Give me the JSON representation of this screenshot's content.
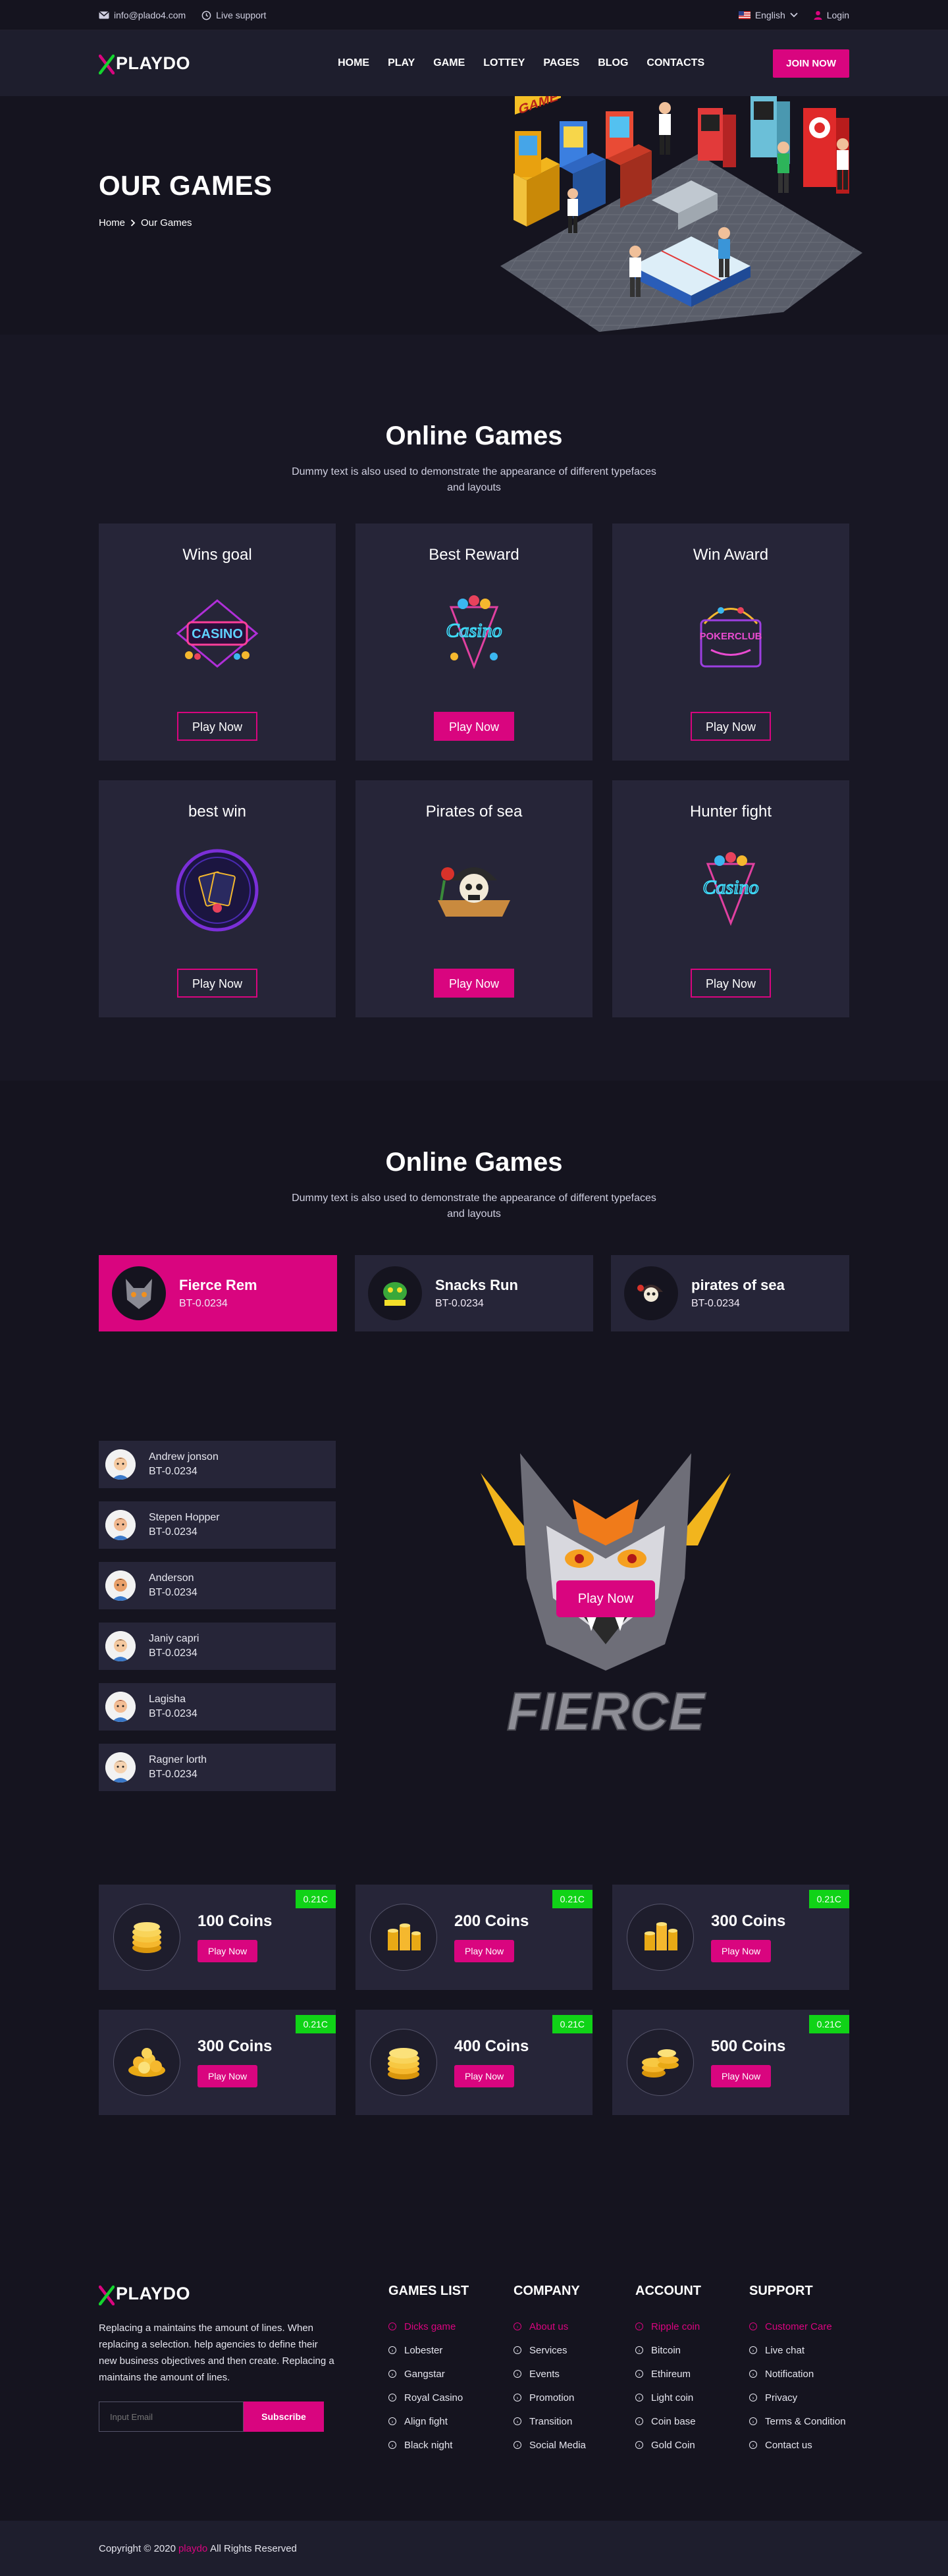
{
  "topbar": {
    "email": "info@plado4.com",
    "support": "Live support",
    "language": "English",
    "login": "Login"
  },
  "header": {
    "logo": "PLAYDO",
    "nav": [
      "HOME",
      "PLAY",
      "GAME",
      "LOTTEY",
      "PAGES",
      "BLOG",
      "CONTACTS"
    ],
    "join": "JOIN NOW"
  },
  "hero": {
    "title": "OUR GAMES",
    "crumb_home": "Home",
    "crumb_current": "Our Games",
    "sign_text": "GAME"
  },
  "games_section": {
    "title": "Online Games",
    "subtitle": "Dummy text is also used to demonstrate the appearance of different typefaces and layouts",
    "cards": [
      {
        "title": "Wins goal",
        "button": "Play Now",
        "filled": false,
        "logo": "CASINO"
      },
      {
        "title": "Best Reward",
        "button": "Play Now",
        "filled": true,
        "logo": "Casino"
      },
      {
        "title": "Win Award",
        "button": "Play Now",
        "filled": false,
        "logo": "POKERCLUB"
      },
      {
        "title": "best win",
        "button": "Play Now",
        "filled": false,
        "logo": ""
      },
      {
        "title": "Pirates of sea",
        "button": "Play Now",
        "filled": true,
        "logo": ""
      },
      {
        "title": "Hunter fight",
        "button": "Play Now",
        "filled": false,
        "logo": "Casino"
      }
    ]
  },
  "leaderboard": {
    "title": "Online Games",
    "subtitle": "Dummy text is also used to demonstrate the appearance of different typefaces and layouts",
    "tabs": [
      {
        "name": "Fierce Rem",
        "bt": "BT-0.0234",
        "active": true
      },
      {
        "name": "Snacks Run",
        "bt": "BT-0.0234",
        "active": false
      },
      {
        "name": "pirates of sea",
        "bt": "BT-0.0234",
        "active": false
      }
    ],
    "players": [
      {
        "name": "Andrew jonson",
        "bt": "BT-0.0234",
        "skin": "#f5c9a0",
        "hair": "#4a2e1b"
      },
      {
        "name": "Stepen Hopper",
        "bt": "BT-0.0234",
        "skin": "#f1b88f",
        "hair": "#3b2416"
      },
      {
        "name": "Anderson",
        "bt": "BT-0.0234",
        "skin": "#e9a06a",
        "hair": "#1f1410"
      },
      {
        "name": "Janiy capri",
        "bt": "BT-0.0234",
        "skin": "#f5c9a0",
        "hair": "#171212"
      },
      {
        "name": "Lagisha",
        "bt": "BT-0.0234",
        "skin": "#f3bd94",
        "hair": "#6b1a1a"
      },
      {
        "name": "Ragner lorth",
        "bt": "BT-0.0234",
        "skin": "#f5d2b0",
        "hair": "#2e2a2a"
      }
    ],
    "feature_button": "Play Now",
    "feature_text": "FIERCE"
  },
  "coins": [
    {
      "title": "100 Coins",
      "badge": "0.21C",
      "button": "Play Now"
    },
    {
      "title": "200 Coins",
      "badge": "0.21C",
      "button": "Play Now"
    },
    {
      "title": "300 Coins",
      "badge": "0.21C",
      "button": "Play Now"
    },
    {
      "title": "300 Coins",
      "badge": "0.21C",
      "button": "Play Now"
    },
    {
      "title": "400 Coins",
      "badge": "0.21C",
      "button": "Play Now"
    },
    {
      "title": "500 Coins",
      "badge": "0.21C",
      "button": "Play Now"
    }
  ],
  "footer": {
    "logo": "PLAYDO",
    "text": "Replacing a maintains the amount of lines. When replacing a selection. help agencies to define their new business objectives and then create. Replacing a maintains the amount of lines.",
    "email_placeholder": "Input Email",
    "subscribe": "Subscribe",
    "columns": [
      {
        "title": "GAMES LIST",
        "items": [
          "Dicks game",
          "Lobester",
          "Gangstar",
          "Royal Casino",
          "Align fight",
          "Black night"
        ]
      },
      {
        "title": "COMPANY",
        "items": [
          "About us",
          "Services",
          "Events",
          "Promotion",
          "Transition",
          "Social Media"
        ]
      },
      {
        "title": "ACCOUNT",
        "items": [
          "Ripple coin",
          "Bitcoin",
          "Ethireum",
          "Light coin",
          "Coin base",
          "Gold Coin"
        ]
      },
      {
        "title": "SUPPORT",
        "items": [
          "Customer Care",
          "Live chat",
          "Notification",
          "Privacy",
          "Terms & Condition",
          "Contact us"
        ]
      }
    ],
    "copyright_pre": "Copyright © 2020",
    "copyright_brand": "playdo",
    "copyright_post": "All Rights Reserved"
  },
  "colors": {
    "accent": "#d9057f",
    "badge": "#10d317",
    "card": "#262538",
    "bg": "#15141f"
  }
}
